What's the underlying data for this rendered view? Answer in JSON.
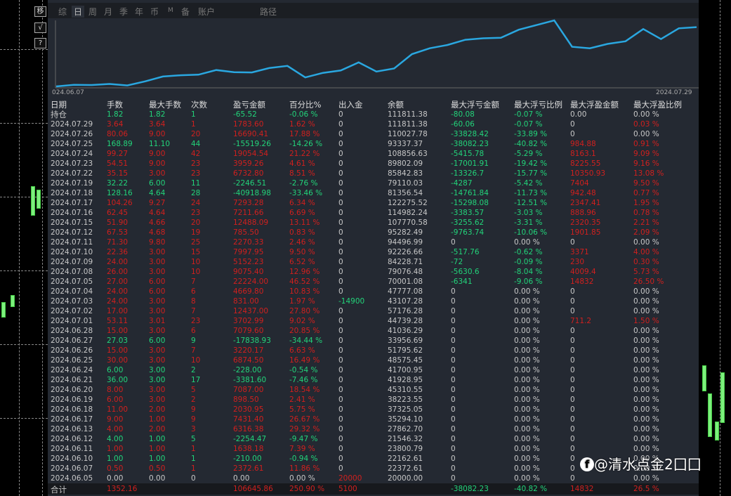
{
  "tabs": [
    "综",
    "日",
    "周",
    "月",
    "季",
    "年",
    "币",
    "M",
    "备",
    "账户",
    "路径"
  ],
  "side_buttons": [
    "移",
    "√",
    "?"
  ],
  "chart": {
    "start_label": "024.06.07",
    "end_label": "2024.07.29",
    "line_color": "#2aa7e0"
  },
  "headers": [
    "日期",
    "手数",
    "最大手数",
    "次数",
    "盈亏金额",
    "百分比%",
    "出入金",
    "余额",
    "最大浮亏金额",
    "最大浮亏比例",
    "最大浮盈金额",
    "最大浮盈比例"
  ],
  "rows": [
    [
      "持仓",
      "1.82",
      "1.82",
      "1",
      "-65.52",
      "-0.06 %",
      "0",
      "111811.38",
      "-80.08",
      "-0.07 %",
      "0.00",
      "0.00 %"
    ],
    [
      "2024.07.29",
      "3.64",
      "3.64",
      "1",
      "1783.60",
      "1.62 %",
      "0",
      "111811.38",
      "-60.06",
      "-0.07 %",
      "0",
      "0.03 %"
    ],
    [
      "2024.07.26",
      "80.06",
      "9.00",
      "20",
      "16690.41",
      "17.88 %",
      "0",
      "110027.78",
      "-33828.42",
      "-33.89 %",
      "0",
      "0.00 %"
    ],
    [
      "2024.07.25",
      "168.89",
      "11.10",
      "44",
      "-15519.26",
      "-14.26 %",
      "0",
      "93337.37",
      "-38082.23",
      "-40.82 %",
      "984.88",
      "0.91 %"
    ],
    [
      "2024.07.24",
      "99.27",
      "9.00",
      "42",
      "19054.54",
      "21.22 %",
      "0",
      "108856.63",
      "-5415.78",
      "-5.29 %",
      "8163.1",
      "9.09 %"
    ],
    [
      "2024.07.23",
      "54.51",
      "9.00",
      "23",
      "3959.26",
      "4.61 %",
      "0",
      "89802.09",
      "-17001.91",
      "-19.42 %",
      "8225.55",
      "9.16 %"
    ],
    [
      "2024.07.22",
      "35.15",
      "3.00",
      "23",
      "6732.80",
      "8.51 %",
      "0",
      "85842.83",
      "-13326.7",
      "-15.77 %",
      "10350.93",
      "13.08 %"
    ],
    [
      "2024.07.19",
      "32.22",
      "6.00",
      "11",
      "-2246.51",
      "-2.76 %",
      "0",
      "79110.03",
      "-4287",
      "-5.42 %",
      "7404",
      "9.50 %"
    ],
    [
      "2024.07.18",
      "128.16",
      "4.64",
      "28",
      "-40918.98",
      "-33.46 %",
      "0",
      "81356.54",
      "-14761.84",
      "-11.73 %",
      "942.48",
      "0.77 %"
    ],
    [
      "2024.07.17",
      "104.26",
      "9.27",
      "24",
      "7293.28",
      "6.34 %",
      "0",
      "122275.52",
      "-15298.08",
      "-12.51 %",
      "2347.41",
      "1.95 %"
    ],
    [
      "2024.07.16",
      "62.45",
      "4.64",
      "23",
      "7211.66",
      "6.69 %",
      "0",
      "114982.24",
      "-3383.57",
      "-3.03 %",
      "888.96",
      "0.78 %"
    ],
    [
      "2024.07.15",
      "51.90",
      "4.66",
      "20",
      "12488.09",
      "13.11 %",
      "0",
      "107770.58",
      "-3255.62",
      "-3.31 %",
      "2320.35",
      "2.21 %"
    ],
    [
      "2024.07.12",
      "67.53",
      "4.68",
      "19",
      "785.50",
      "0.83 %",
      "0",
      "95282.49",
      "-9763.74",
      "-10.06 %",
      "1901.85",
      "2.09 %"
    ],
    [
      "2024.07.11",
      "71.30",
      "9.80",
      "25",
      "2270.33",
      "2.46 %",
      "0",
      "94496.99",
      "0",
      "0.00 %",
      "0",
      "0.00 %"
    ],
    [
      "2024.07.10",
      "22.36",
      "3.00",
      "15",
      "7997.95",
      "9.50 %",
      "0",
      "92226.66",
      "-517.76",
      "-0.62 %",
      "3371",
      "4.00 %"
    ],
    [
      "2024.07.09",
      "24.00",
      "3.00",
      "10",
      "5152.23",
      "6.52 %",
      "0",
      "84228.71",
      "-72",
      "-0.09 %",
      "230",
      "0.30 %"
    ],
    [
      "2024.07.08",
      "26.00",
      "3.00",
      "10",
      "9075.40",
      "12.96 %",
      "0",
      "79076.48",
      "-5630.6",
      "-8.04 %",
      "4009.4",
      "5.73 %"
    ],
    [
      "2024.07.05",
      "27.00",
      "6.00",
      "7",
      "22224.00",
      "46.52 %",
      "0",
      "70001.08",
      "-6341",
      "-9.06 %",
      "14832",
      "26.50 %"
    ],
    [
      "2024.07.04",
      "24.00",
      "6.00",
      "6",
      "4669.80",
      "10.83 %",
      "0",
      "47777.08",
      "0",
      "0.00 %",
      "0",
      "0.00 %"
    ],
    [
      "2024.07.03",
      "24.00",
      "3.00",
      "8",
      "831.00",
      "1.97 %",
      "-14900",
      "43107.28",
      "0",
      "0.00 %",
      "0",
      "0.00 %"
    ],
    [
      "2024.07.02",
      "17.00",
      "3.00",
      "7",
      "12437.00",
      "27.80 %",
      "0",
      "57176.28",
      "0",
      "0.00 %",
      "0",
      "0.00 %"
    ],
    [
      "2024.07.01",
      "53.11",
      "3.01",
      "23",
      "3702.99",
      "9.02 %",
      "0",
      "44739.28",
      "0",
      "0.00 %",
      "711.2",
      "1.50 %"
    ],
    [
      "2024.06.28",
      "15.00",
      "3.00",
      "6",
      "7079.60",
      "20.85 %",
      "0",
      "41036.29",
      "0",
      "0.00 %",
      "0",
      "0.00 %"
    ],
    [
      "2024.06.27",
      "27.03",
      "6.00",
      "9",
      "-17838.93",
      "-34.44 %",
      "0",
      "33956.69",
      "0",
      "0.00 %",
      "0",
      "0.00 %"
    ],
    [
      "2024.06.26",
      "15.00",
      "3.00",
      "7",
      "3220.17",
      "6.63 %",
      "0",
      "51795.62",
      "0",
      "0.00 %",
      "0",
      "0.00 %"
    ],
    [
      "2024.06.25",
      "30.00",
      "3.00",
      "10",
      "6874.50",
      "16.49 %",
      "0",
      "48575.45",
      "0",
      "0.00 %",
      "0",
      "0.00 %"
    ],
    [
      "2024.06.24",
      "6.00",
      "3.00",
      "2",
      "-228.00",
      "-0.54 %",
      "0",
      "41700.95",
      "0",
      "0.00 %",
      "0",
      "0.00 %"
    ],
    [
      "2024.06.21",
      "36.00",
      "3.00",
      "17",
      "-3381.60",
      "-7.46 %",
      "0",
      "41928.95",
      "0",
      "0.00 %",
      "0",
      "0.00 %"
    ],
    [
      "2024.06.20",
      "8.00",
      "3.00",
      "5",
      "7087.00",
      "18.54 %",
      "0",
      "45310.55",
      "0",
      "0.00 %",
      "0",
      "0.00 %"
    ],
    [
      "2024.06.19",
      "6.00",
      "3.00",
      "2",
      "898.50",
      "2.41 %",
      "0",
      "38223.55",
      "0",
      "0.00 %",
      "0",
      "0.00 %"
    ],
    [
      "2024.06.18",
      "11.00",
      "2.00",
      "9",
      "2030.95",
      "5.75 %",
      "0",
      "37325.05",
      "0",
      "0.00 %",
      "0",
      "0.00 %"
    ],
    [
      "2024.06.17",
      "9.00",
      "1.00",
      "9",
      "7431.40",
      "26.67 %",
      "0",
      "35294.10",
      "0",
      "0.00 %",
      "0",
      "0.00 %"
    ],
    [
      "2024.06.13",
      "4.00",
      "2.00",
      "3",
      "6316.38",
      "29.32 %",
      "0",
      "27862.70",
      "0",
      "0.00 %",
      "0",
      "0.00 %"
    ],
    [
      "2024.06.12",
      "4.00",
      "1.00",
      "5",
      "-2254.47",
      "-9.47 %",
      "0",
      "21546.32",
      "0",
      "0.00 %",
      "0",
      "0.00 %"
    ],
    [
      "2024.06.11",
      "1.00",
      "1.00",
      "1",
      "1638.18",
      "7.39 %",
      "0",
      "23800.79",
      "0",
      "0.00 %",
      "0",
      "0.00 %"
    ],
    [
      "2024.06.10",
      "1.00",
      "1.00",
      "1",
      "-210.00",
      "-0.94 %",
      "0",
      "22162.61",
      "0",
      "0.00 %",
      "0",
      "0.00 %"
    ],
    [
      "2024.06.07",
      "0.50",
      "0.50",
      "1",
      "2372.61",
      "11.86 %",
      "0",
      "22372.61",
      "0",
      "0.00 %",
      "0",
      "0.00 %"
    ],
    [
      "2024.06.05",
      "0.00",
      "0.00",
      "0",
      "0.00",
      "0.00 %",
      "20000",
      "20000.00",
      "0",
      "0.00 %",
      "0",
      "0.00 %"
    ]
  ],
  "total": {
    "label": "合计",
    "lots": "1352.16",
    "pnl": "106645.86",
    "pct": "250.90 %",
    "inout": "5100",
    "maxloss": "-38082.23",
    "maxlosspct": "-40.82 %",
    "maxprofit": "14832",
    "maxprofitpct": "26.5 %"
  },
  "watermark": "@清水点金2囗囗"
}
